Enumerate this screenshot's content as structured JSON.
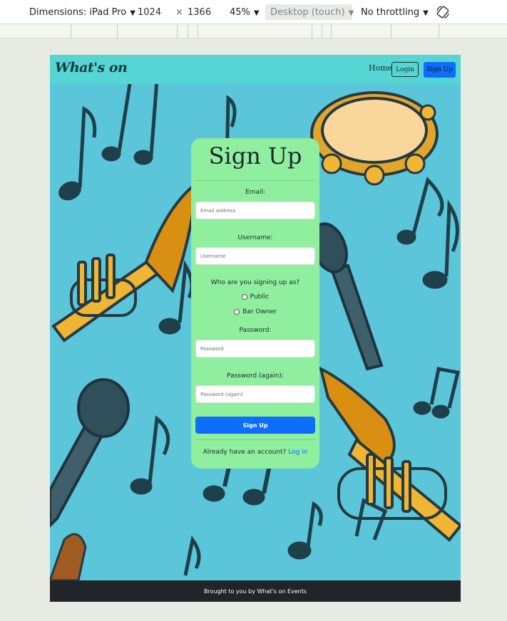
{
  "devtools": {
    "dimensions_label": "Dimensions: iPad Pro",
    "width": "1024",
    "times": "×",
    "height": "1366",
    "zoom": "45%",
    "mode": "Desktop (touch)",
    "throttling": "No throttling",
    "rotate_icon": "rotate-icon"
  },
  "site": {
    "brand": "What's on",
    "nav": {
      "home": "Home",
      "login": "Login",
      "signup": "Sign Up"
    }
  },
  "signup_form": {
    "title": "Sign Up",
    "email_label": "Email:",
    "email_placeholder": "Email address",
    "username_label": "Username:",
    "username_placeholder": "Username",
    "role_question": "Who are you signing up as?",
    "role_options": [
      "Public",
      "Bar Owner"
    ],
    "password_label": "Password:",
    "password_placeholder": "Password",
    "password_again_label": "Password (again):",
    "password_again_placeholder": "Password (again)",
    "submit_label": "Sign Up",
    "already_text": "Already have an account?",
    "login_link": "Log in"
  },
  "footer": {
    "text": "Brought to you by What's on Events"
  },
  "colors": {
    "navbar": "#55d5d3",
    "page_bg": "#5bc6d9",
    "card": "#90ee9f",
    "primary": "#0d6efd",
    "footer": "#212529"
  }
}
